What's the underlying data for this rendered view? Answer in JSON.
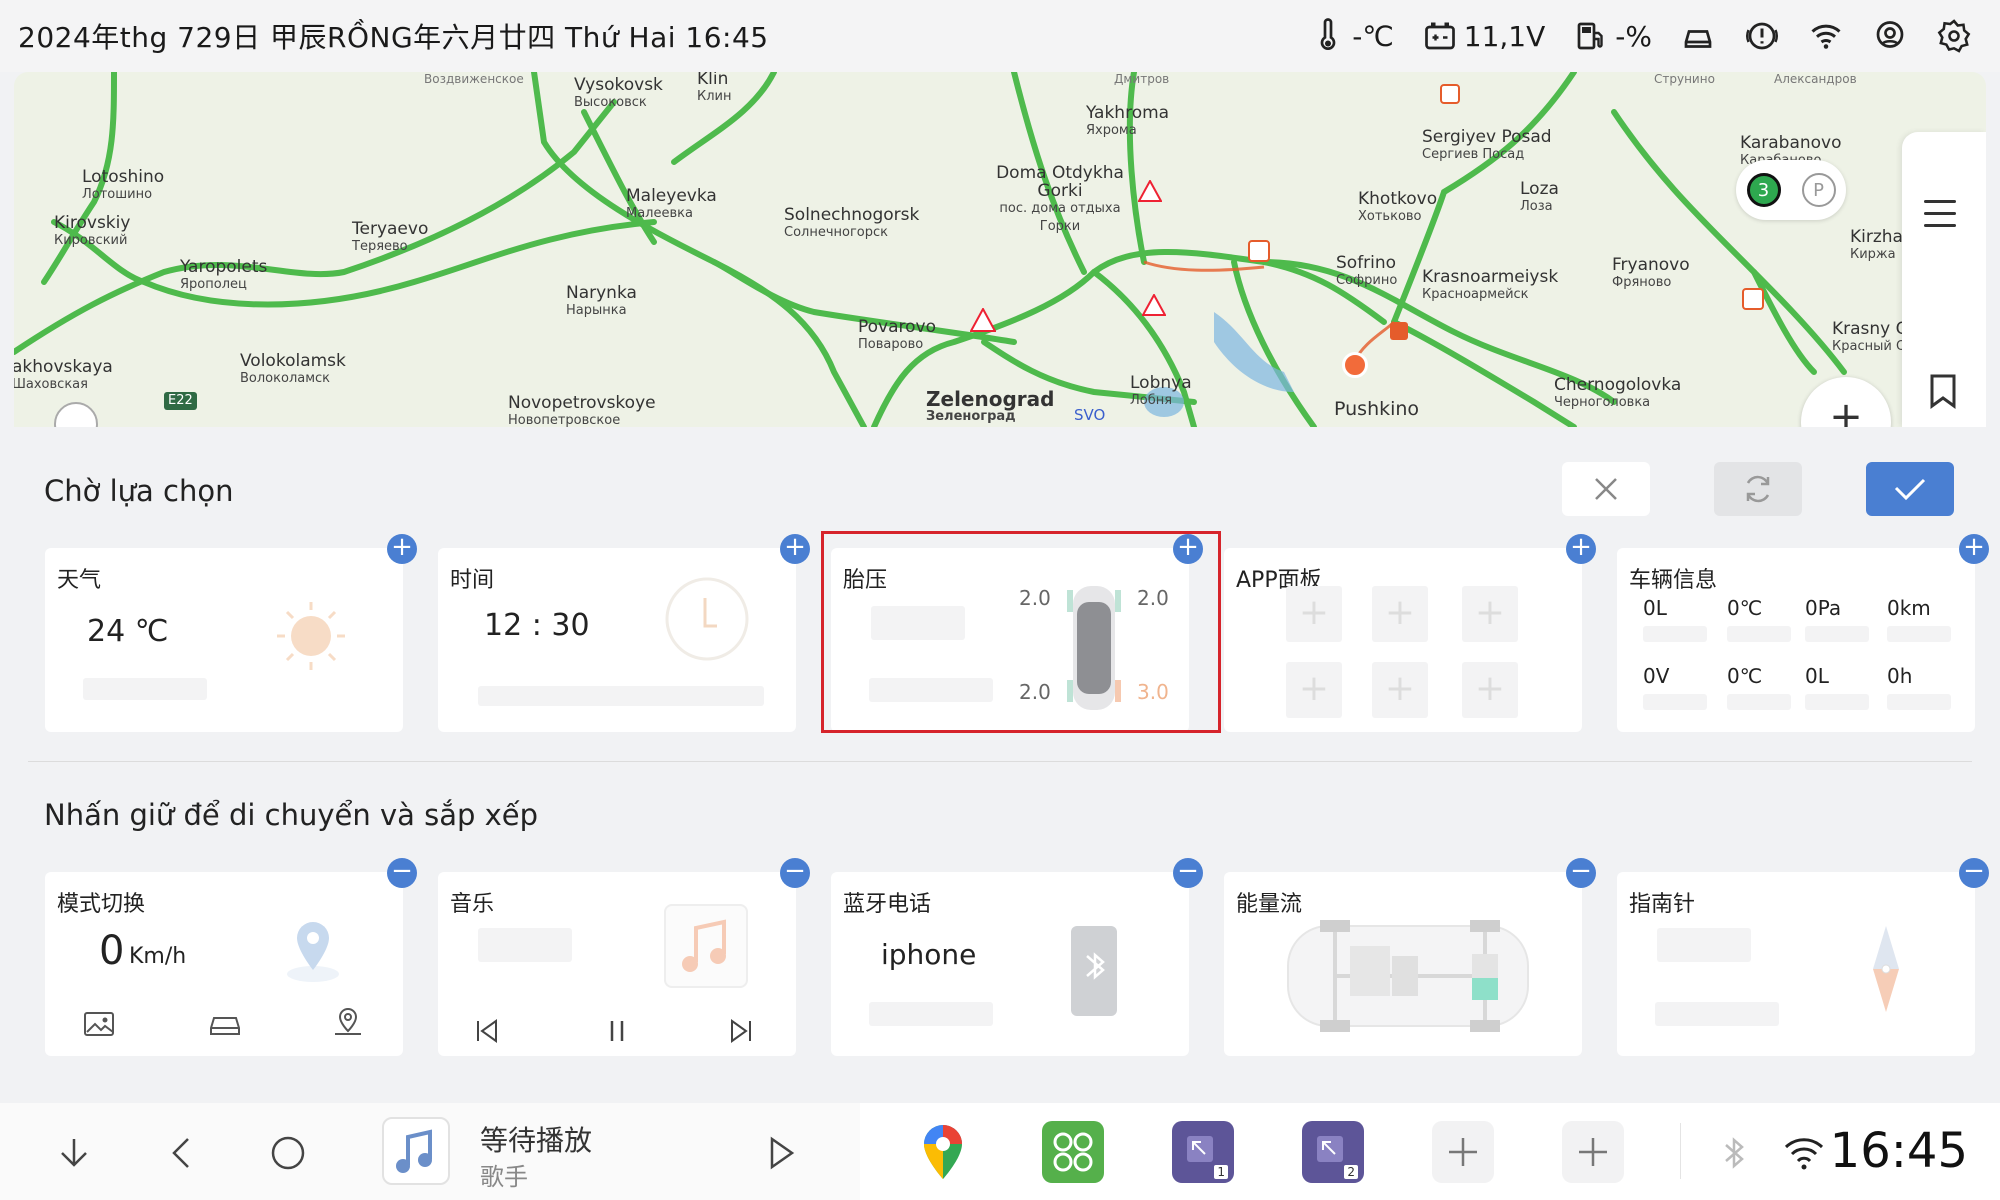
{
  "status": {
    "date": "2024年thg 729日  甲辰RỒNG年六月廿四  Thứ Hai  16:45",
    "temp": "-℃",
    "voltage": "11,1V",
    "fuel": "-%"
  },
  "map": {
    "cities": [
      {
        "en": "Vysokovsk",
        "ru": "Высоковск"
      },
      {
        "en": "Klin",
        "ru": "Клин"
      },
      {
        "en": "Yakhroma",
        "ru": "Яхрома"
      },
      {
        "en": "Sergiyev Posad",
        "ru": "Сергиев Посад"
      },
      {
        "en": "Karabanovo",
        "ru": "Карабаново"
      },
      {
        "en": "Lotoshino",
        "ru": "Лотошино"
      },
      {
        "en": "Maleyevka",
        "ru": "Малеевка"
      },
      {
        "en": "Doma Otdykha Gorki",
        "ru": "пос. дома отдыха Горки"
      },
      {
        "en": "Khotkovo",
        "ru": "Хотьково"
      },
      {
        "en": "Loza",
        "ru": "Лоза"
      },
      {
        "en": "Kirovskiy",
        "ru": "Кировский"
      },
      {
        "en": "Teryaevo",
        "ru": "Теряево"
      },
      {
        "en": "Solnechnogorsk",
        "ru": "Солнечногорск"
      },
      {
        "en": "Kirzha",
        "ru": "Киржа"
      },
      {
        "en": "Yaropolets",
        "ru": "Ярополец"
      },
      {
        "en": "Sofrino",
        "ru": "Софрино"
      },
      {
        "en": "Fryanovo",
        "ru": "Фряново"
      },
      {
        "en": "Krasnoarmeiysk",
        "ru": "Красноармейск"
      },
      {
        "en": "Narynka",
        "ru": "Нарынка"
      },
      {
        "en": "Krasny O",
        "ru": "Красный О"
      },
      {
        "en": "Povarovo",
        "ru": "Поварово"
      },
      {
        "en": "akhovskaya",
        "ru": "Шаховская"
      },
      {
        "en": "Volokolamsk",
        "ru": "Волоколамск"
      },
      {
        "en": "Chernogolovka",
        "ru": "Черноголовка"
      },
      {
        "en": "Lobnya",
        "ru": "Лобня"
      },
      {
        "en": "Zelenograd",
        "ru": "Зеленоград"
      },
      {
        "en": "Novopetrovskoye",
        "ru": "Новопетровское"
      },
      {
        "en": "Pushkino",
        "ru": ""
      }
    ],
    "road_label": "E22",
    "airport": "SVO",
    "badge_count": "3",
    "parking": "P",
    "top_edge": [
      "Воздвиженское",
      "Дмитров",
      "Струнино",
      "Александров"
    ]
  },
  "pending": {
    "title": "Chờ lựa chọn",
    "cards": {
      "weather": {
        "title": "天气",
        "temp": "24 ℃"
      },
      "time": {
        "title": "时间",
        "value": "12 : 30"
      },
      "tire": {
        "title": "胎压",
        "fl": "2.0",
        "fr": "2.0",
        "rl": "2.0",
        "rr": "3.0"
      },
      "apps": {
        "title": "APP面板"
      },
      "vehicle": {
        "title": "车辆信息",
        "row1": [
          "0L",
          "0℃",
          "0Pa",
          "0km"
        ],
        "row2": [
          "0V",
          "0℃",
          "0L",
          "0h"
        ]
      }
    }
  },
  "arranged": {
    "title": "Nhấn giữ để di chuyển và sắp xếp",
    "cards": {
      "mode": {
        "title": "模式切换",
        "speed": "0",
        "unit": "Km/h"
      },
      "music": {
        "title": "音乐"
      },
      "bt": {
        "title": "蓝牙电话",
        "device": "iphone"
      },
      "energy": {
        "title": "能量流"
      },
      "compass": {
        "title": "指南针"
      }
    }
  },
  "dock": {
    "now_playing": "等待播放",
    "artist": "歌手",
    "clock": "16:45",
    "window1": "1",
    "window2": "2"
  },
  "colors": {
    "accent": "#4a7fd2",
    "highlight": "#d6242b",
    "road": "#3db43c",
    "app_green": "#55b04b",
    "app_purple": "#5d5598"
  }
}
